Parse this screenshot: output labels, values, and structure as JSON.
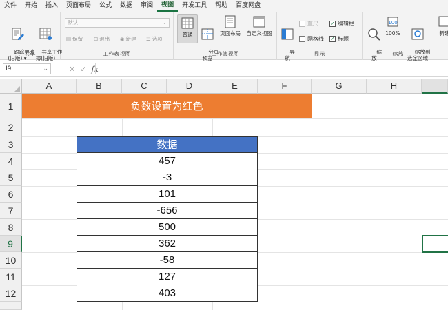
{
  "menu": [
    "文件",
    "开始",
    "插入",
    "页面布局",
    "公式",
    "数据",
    "审阅",
    "视图",
    "开发工具",
    "帮助",
    "百度网盘"
  ],
  "menu_active_index": 7,
  "ribbon": {
    "share": {
      "label": "共享",
      "track_changes": "跟踪更改\n(旧版) ▾",
      "share_workbook": "共享工作\n簿(旧版)"
    },
    "sheetview": {
      "label": "工作表视图",
      "dropdown": "默认",
      "keep": "保留",
      "exit": "退出",
      "new": "新建",
      "options": "选项"
    },
    "workbookview": {
      "label": "工作簿视图",
      "normal": "普通",
      "pagebreak": "分页\n预览",
      "pagelayout": "页面布局",
      "custom": "自定义视图"
    },
    "show": {
      "label": "显示",
      "navigate": "导\n航",
      "ruler": "直尺",
      "formulabar": "编辑栏",
      "gridlines": "网格线",
      "headings": "标题"
    },
    "zoom": {
      "label": "缩放",
      "zoom": "缩\n放",
      "zoom100": "100%",
      "zoomsel": "缩放到\n选定区域"
    },
    "window": {
      "newwin": "新建"
    }
  },
  "formula_bar": {
    "namebox": "I9",
    "cancel": "✕",
    "enter": "✓",
    "fx": "fx",
    "value": ""
  },
  "columns": [
    "A",
    "B",
    "C",
    "D",
    "E",
    "F",
    "G",
    "H"
  ],
  "rows": [
    "1",
    "2",
    "3",
    "4",
    "5",
    "6",
    "7",
    "8",
    "9",
    "10",
    "11",
    "12"
  ],
  "sheet": {
    "title": "负数设置为红色",
    "table_header": "数据",
    "values": [
      "457",
      "-3",
      "101",
      "-656",
      "500",
      "362",
      "-58",
      "127",
      "403"
    ]
  },
  "colors": {
    "banner": "#ed7d31",
    "table_header": "#4472c4",
    "selection": "#217346"
  }
}
